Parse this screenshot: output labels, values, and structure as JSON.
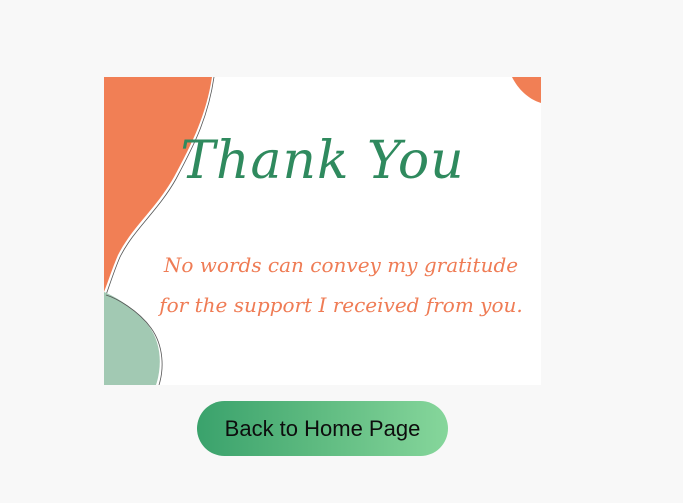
{
  "card": {
    "title": "Thank You",
    "message": "No words can convey my gratitude for the support I received from you.",
    "colors": {
      "orange": "#f17f55",
      "green": "#2f8a5e",
      "mint": "#a2c9b3",
      "text_orange": "#ef7c55"
    }
  },
  "actions": {
    "back_label": "Back to Home Page"
  }
}
